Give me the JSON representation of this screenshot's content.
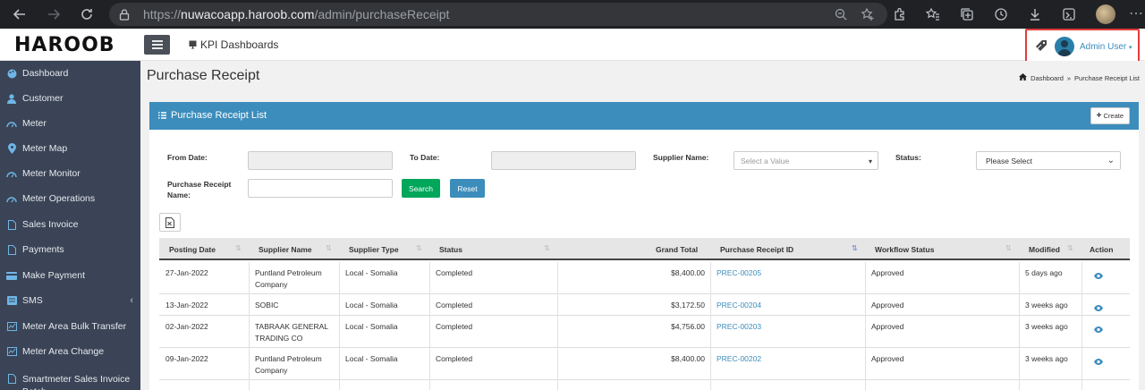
{
  "browser": {
    "url_scheme": "https://",
    "url_host": "nuwacoapp.haroob.com",
    "url_path": "/admin/purchaseReceipt"
  },
  "header": {
    "logo": "HAROOB",
    "kpi_label": "KPI Dashboards",
    "user_name": "Admin User"
  },
  "sidebar": {
    "items": [
      {
        "label": "Dashboard",
        "icon": "palette-icon"
      },
      {
        "label": "Customer",
        "icon": "user-icon"
      },
      {
        "label": "Meter",
        "icon": "gauge-icon"
      },
      {
        "label": "Meter Map",
        "icon": "map-marker-icon"
      },
      {
        "label": "Meter Monitor",
        "icon": "gauge-icon"
      },
      {
        "label": "Meter Operations",
        "icon": "gauge-icon"
      },
      {
        "label": "Sales Invoice",
        "icon": "file-icon"
      },
      {
        "label": "Payments",
        "icon": "file-icon"
      },
      {
        "label": "Make Payment",
        "icon": "card-icon"
      },
      {
        "label": "SMS",
        "icon": "sms-icon"
      },
      {
        "label": "Meter Area Bulk Transfer",
        "icon": "chart-icon"
      },
      {
        "label": "Meter Area Change",
        "icon": "chart-icon"
      },
      {
        "label": "Smartmeter Sales Invoice Batch",
        "icon": "file-icon"
      }
    ]
  },
  "page": {
    "title": "Purchase Receipt",
    "breadcrumb_home": "Dashboard",
    "breadcrumb_sep": "»",
    "breadcrumb_current": "Purchase Receipt List"
  },
  "box": {
    "title": "Purchase Receipt List",
    "create_label": "Create"
  },
  "filters": {
    "from_date_label": "From Date:",
    "to_date_label": "To Date:",
    "supplier_label": "Supplier Name:",
    "supplier_placeholder": "Select a Value",
    "status_label": "Status:",
    "status_value": "Please Select",
    "receipt_name_label": "Purchase Receipt Name:",
    "search_label": "Search",
    "reset_label": "Reset"
  },
  "table": {
    "headers": [
      "Posting Date",
      "Supplier Name",
      "Supplier Type",
      "Status",
      "Grand Total",
      "Purchase Receipt ID",
      "Workflow Status",
      "Modified",
      "Action"
    ],
    "rows": [
      {
        "date": "27-Jan-2022",
        "supplier": "Puntland Petroleum Company",
        "type": "Local - Somalia",
        "status": "Completed",
        "total": "$8,400.00",
        "id": "PREC-00205",
        "workflow": "Approved",
        "modified": "5 days ago"
      },
      {
        "date": "13-Jan-2022",
        "supplier": "SOBIC",
        "type": "Local - Somalia",
        "status": "Completed",
        "total": "$3,172.50",
        "id": "PREC-00204",
        "workflow": "Approved",
        "modified": "3 weeks ago"
      },
      {
        "date": "02-Jan-2022",
        "supplier": "TABRAAK GENERAL TRADING CO",
        "type": "Local - Somalia",
        "status": "Completed",
        "total": "$4,756.00",
        "id": "PREC-00203",
        "workflow": "Approved",
        "modified": "3 weeks ago"
      },
      {
        "date": "09-Jan-2022",
        "supplier": "Puntland Petroleum Company",
        "type": "Local - Somalia",
        "status": "Completed",
        "total": "$8,400.00",
        "id": "PREC-00202",
        "workflow": "Approved",
        "modified": "3 weeks ago"
      }
    ]
  },
  "colors": {
    "primary": "#3c8dbc",
    "success": "#00a65a",
    "sidebar": "#3a4456",
    "highlight": "#e03c3c"
  }
}
